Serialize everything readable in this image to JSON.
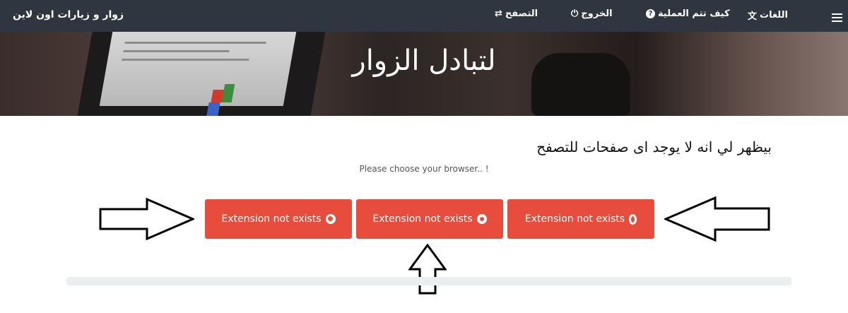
{
  "navbar": {
    "brand": "زوار و زيارات اون لاين",
    "items": [
      {
        "label": "التصفح",
        "icon": "exchange-icon",
        "glyph": "⇄"
      },
      {
        "label": "الخروج",
        "icon": "power-icon",
        "glyph": "⏻"
      },
      {
        "label": "كيف تتم العملية",
        "icon": "question-circle-icon",
        "glyph": "?"
      },
      {
        "label": "اللغات",
        "icon": "language-icon",
        "glyph": "文"
      }
    ]
  },
  "hero": {
    "title": "لتبادل الزوار"
  },
  "main": {
    "headline": "بيظهر لي انه لا يوجد اى صفحات للتصفح",
    "subtitle": "Please choose your browser.. !",
    "buttons": [
      {
        "label": "Extension not exists",
        "icon": "firefox-icon"
      },
      {
        "label": "Extension not exists",
        "icon": "chrome-icon"
      },
      {
        "label": "Extension not exists",
        "icon": "opera-icon"
      }
    ],
    "progress": 0
  },
  "colors": {
    "navbar": "#2f3640",
    "button": "#e74c3c",
    "progress_track": "#eceff2"
  }
}
